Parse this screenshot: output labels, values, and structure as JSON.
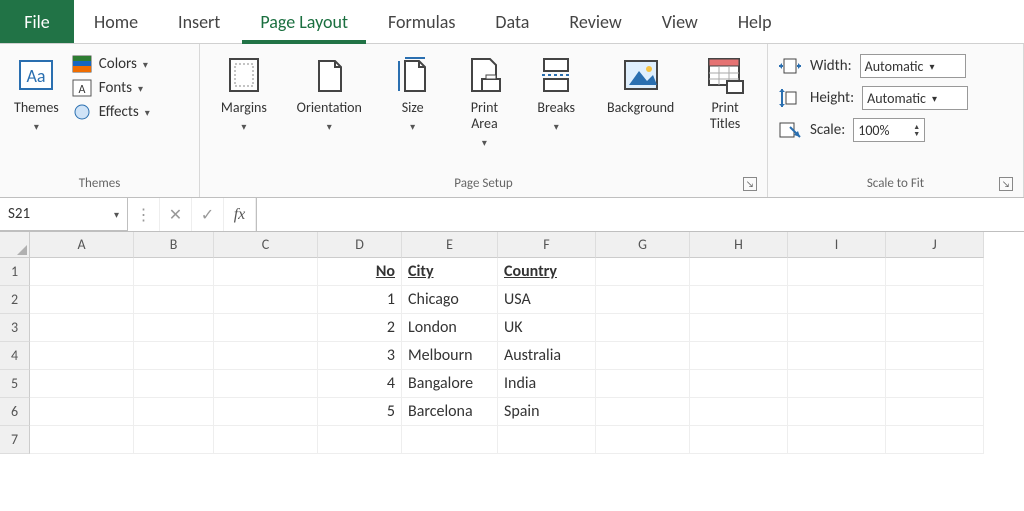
{
  "tabs": {
    "file": "File",
    "items": [
      "Home",
      "Insert",
      "Page Layout",
      "Formulas",
      "Data",
      "Review",
      "View",
      "Help"
    ],
    "active_index": 2
  },
  "ribbon": {
    "themes": {
      "label": "Themes",
      "themes_btn": "Themes",
      "colors": "Colors",
      "fonts": "Fonts",
      "effects": "Effects"
    },
    "page_setup": {
      "label": "Page Setup",
      "margins": "Margins",
      "orientation": "Orientation",
      "size": "Size",
      "print_area": "Print\nArea",
      "breaks": "Breaks",
      "background": "Background",
      "print_titles": "Print\nTitles"
    },
    "scale_to_fit": {
      "label": "Scale to Fit",
      "width_label": "Width:",
      "width_value": "Automatic",
      "height_label": "Height:",
      "height_value": "Automatic",
      "scale_label": "Scale:",
      "scale_value": "100%"
    }
  },
  "formula_bar": {
    "name_box": "S21",
    "fx_label": "fx",
    "value": ""
  },
  "grid": {
    "columns": [
      "A",
      "B",
      "C",
      "D",
      "E",
      "F",
      "G",
      "H",
      "I",
      "J"
    ],
    "rows": [
      1,
      2,
      3,
      4,
      5,
      6,
      7
    ],
    "headers": {
      "no": "No",
      "city": "City",
      "country": "Country"
    },
    "data": [
      {
        "no": "1",
        "city": "Chicago",
        "country": "USA"
      },
      {
        "no": "2",
        "city": "London",
        "country": "UK"
      },
      {
        "no": "3",
        "city": "Melbourn",
        "country": "Australia"
      },
      {
        "no": "4",
        "city": "Bangalore",
        "country": "India"
      },
      {
        "no": "5",
        "city": "Barcelona",
        "country": "Spain"
      }
    ]
  }
}
